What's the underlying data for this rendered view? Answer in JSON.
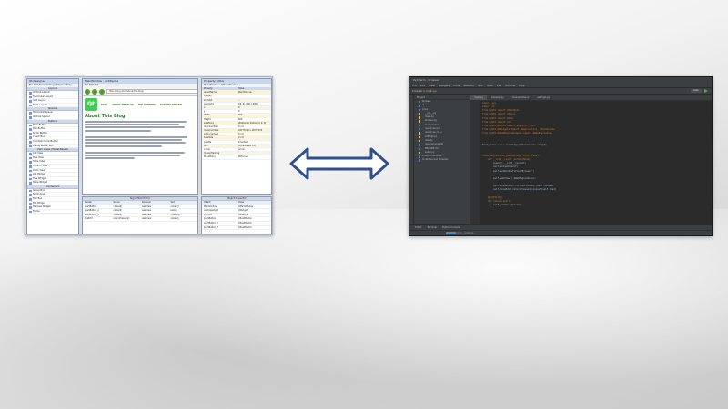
{
  "colors": {
    "arrow": "#2f4f8f",
    "qt_green": "#41cd52",
    "pycharm_bg": "#2b2b2b"
  },
  "designer": {
    "widget_box": {
      "title": "Qt Designer",
      "sections": [
        "Layouts",
        "Spacers",
        "Buttons",
        "Item Views (Model-Based)",
        "Containers"
      ],
      "items": [
        "Vertical Layout",
        "Horizontal Layout",
        "Grid Layout",
        "Form Layout",
        "Horizontal Spacer",
        "Vertical Spacer",
        "Push Button",
        "Tool Button",
        "Radio Button",
        "Check Box",
        "Command Link Button",
        "Dialog Button Box",
        "List View",
        "Tree View",
        "Table View",
        "Column View",
        "Undo View",
        "List Widget",
        "Tree Widget",
        "Table Widget",
        "Group Box",
        "Scroll Area",
        "Tool Box",
        "Tab Widget",
        "Stacked Widget",
        "Frame"
      ]
    },
    "blog": {
      "title": "MainWindow - untitled.ui",
      "menu": [
        "File",
        "Edit",
        "Tab"
      ],
      "url": "http://blog.qt.io/about-the-blog/",
      "logo": "Qt",
      "nav": [
        "BLOG",
        "ABOUT THE BLOG",
        "THE AUTHORS",
        "ACTIVITY STREAM"
      ],
      "heading": "About This Blog"
    },
    "property_editor": {
      "title": "Property Editor",
      "object": "MainWindow : QMainWindow",
      "columns": [
        "Property",
        "Value"
      ],
      "rows": [
        [
          "objectName",
          "MainWindow"
        ],
        [
          "QObject",
          ""
        ],
        [
          "enabled",
          "✓"
        ],
        [
          "geometry",
          "[(0, 0), 800 x 600]"
        ],
        [
          "x",
          "0"
        ],
        [
          "y",
          "0"
        ],
        [
          "Width",
          "800"
        ],
        [
          "Height",
          "600"
        ],
        [
          "sizePolicy",
          "[Preferred, Preferred, 0, 0]"
        ],
        [
          "minimumSize",
          "0 x 0"
        ],
        [
          "maximumSize",
          "16777215 x 16777215"
        ],
        [
          "sizeIncrement",
          "0 x 0"
        ],
        [
          "baseSize",
          "0 x 0"
        ],
        [
          "palette",
          "Inherited"
        ],
        [
          "font",
          "A [Cantarell, 11]"
        ],
        [
          "cursor",
          "Arrow"
        ],
        [
          "mouseTracking",
          ""
        ],
        [
          "focusPolicy",
          "NoFocus"
        ]
      ]
    },
    "signal_editor": {
      "title": "Signal/Slot Editor",
      "columns": [
        "Sender",
        "Signal",
        "Receiver",
        "Slot"
      ],
      "rows": [
        [
          "pushButton",
          "clicked()",
          "webView",
          "reload()"
        ],
        [
          "pushButton_2",
          "clicked()",
          "webView",
          "back()"
        ],
        [
          "pushButton_3",
          "clicked()",
          "webView",
          "forward()"
        ],
        [
          "lineEdit",
          "returnPressed()",
          "webView",
          "reload()"
        ]
      ]
    },
    "object_inspector": {
      "title": "Object Inspector",
      "columns": [
        "Object",
        "Class"
      ],
      "rows": [
        [
          "MainWindow",
          "QMainWindow"
        ],
        [
          "centralwidget",
          "QWidget"
        ],
        [
          "lineEdit",
          "QLineEdit"
        ],
        [
          "pushButton",
          "QPushButton"
        ],
        [
          "pushButton_2",
          "QPushButton"
        ],
        [
          "pushButton_3",
          "QPushButton"
        ],
        [
          "webView",
          "QWebView"
        ],
        [
          "menubar",
          "QMenuBar"
        ],
        [
          "statusbar",
          "QStatusBar"
        ]
      ]
    }
  },
  "pycharm": {
    "title": "PyCharm - browser",
    "menu": [
      "File",
      "Edit",
      "View",
      "Navigate",
      "Code",
      "Refactor",
      "Run",
      "Tools",
      "VCS",
      "Window",
      "Help"
    ],
    "breadcrumb": "browser > main.py",
    "run_config": "main",
    "project_header": "Project",
    "files": [
      [
        "browser",
        "dir"
      ],
      [
        "ui",
        "dir"
      ],
      [
        "icons",
        "dir"
      ],
      [
        "__init__.py",
        "py"
      ],
      [
        "main.py",
        "py"
      ],
      [
        "browser.py",
        "py"
      ],
      [
        "mainwindow.ui",
        "file"
      ],
      [
        "resources.qrc",
        "file"
      ],
      [
        "resources_rc.py",
        "py"
      ],
      [
        "settings.py",
        "py"
      ],
      [
        "utils.py",
        "py"
      ],
      [
        "requirements.txt",
        "file"
      ],
      [
        "README.md",
        "file"
      ],
      [
        "setup.py",
        "py"
      ],
      [
        "External Libraries",
        "dir"
      ],
      [
        "Scratches and Consoles",
        "dir"
      ]
    ],
    "tabs": [
      "main.py",
      "browser.py",
      "mainwindow.ui",
      "settings.py"
    ],
    "active_tab": "main.py",
    "code_lines": [
      "import sys",
      "import os",
      "from PyQt5 import QtWidgets",
      "from PyQt5 import QtCore",
      "from PyQt5 import QtGui",
      "from PyQt5 import uic",
      "from PyQt5.QtCore import pyqtSlot, QUrl",
      "from PyQt5.QtWidgets import QApplication, QMainWindow",
      "from PyQt5.QtWebEngineWidgets import QWebEngineView",
      "",
      "",
      "Form_class = uic.loadUiType(\"mainwindow.ui\")[0]",
      "",
      "",
      "class MainWindow(QMainWindow, Form_class):",
      "    def __init__(self, parent=None):",
      "        super().__init__(parent)",
      "        self.setupUi(self)",
      "        self.setWindowTitle(\"Browser\")",
      "",
      "        self.webView = QWebEngineView()",
      "",
      "        self.pushButton.clicked.connect(self.reload)",
      "        self.lineEdit.returnPressed.connect(self.load)",
      "",
      "    @pyqtSlot()",
      "    def reload(self):",
      "        self.webView.reload()"
    ],
    "tool_windows": [
      "TODO",
      "Terminal",
      "Python Console"
    ],
    "status_text": "Indexing...",
    "indexing_progress": 0.6
  }
}
